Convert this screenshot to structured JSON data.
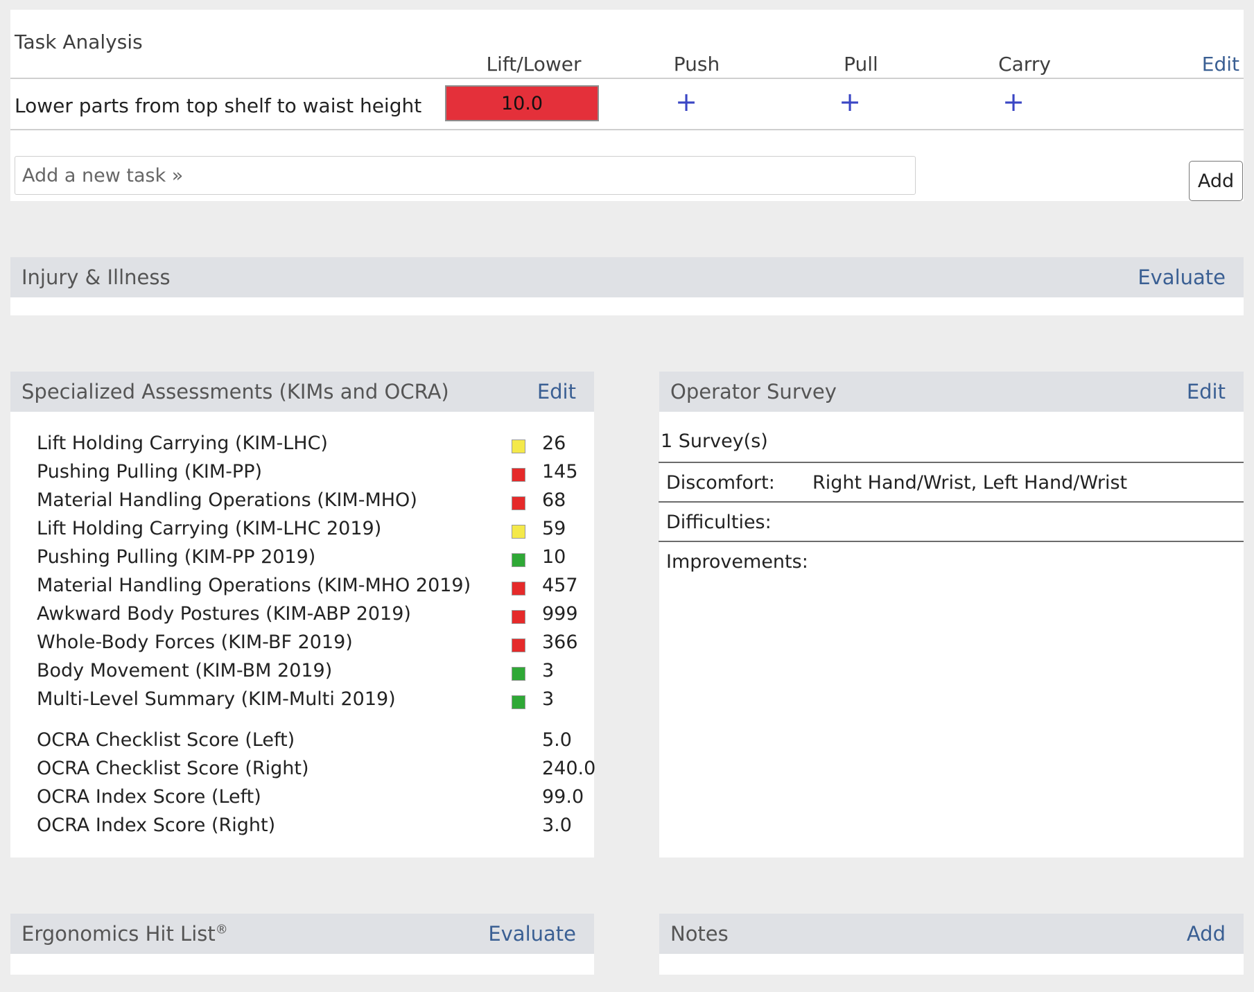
{
  "task_analysis": {
    "title": "Task Analysis",
    "columns": [
      "Lift/Lower",
      "Push",
      "Pull",
      "Carry"
    ],
    "edit_label": "Edit",
    "task": {
      "name": "Lower parts from top shelf to waist height",
      "lift_lower_score": "10.0",
      "score_color": "#e4303a"
    },
    "add_symbol": "+",
    "new_task_placeholder": "Add a new task »",
    "add_button": "Add"
  },
  "injury_illness": {
    "title": "Injury & Illness",
    "action": "Evaluate"
  },
  "specialized": {
    "title": "Specialized Assessments (KIMs and OCRA)",
    "action": "Edit",
    "kims": [
      {
        "label": "Lift Holding Carrying (KIM-LHC)",
        "value": "26",
        "level": "yellow"
      },
      {
        "label": "Pushing Pulling (KIM-PP)",
        "value": "145",
        "level": "red"
      },
      {
        "label": "Material Handling Operations (KIM-MHO)",
        "value": "68",
        "level": "red"
      },
      {
        "label": "Lift Holding Carrying (KIM-LHC 2019)",
        "value": "59",
        "level": "yellow"
      },
      {
        "label": "Pushing Pulling (KIM-PP 2019)",
        "value": "10",
        "level": "green"
      },
      {
        "label": "Material Handling Operations (KIM-MHO 2019)",
        "value": "457",
        "level": "red"
      },
      {
        "label": "Awkward Body Postures (KIM-ABP 2019)",
        "value": "999",
        "level": "red"
      },
      {
        "label": "Whole-Body Forces (KIM-BF 2019)",
        "value": "366",
        "level": "red"
      },
      {
        "label": "Body Movement (KIM-BM 2019)",
        "value": "3",
        "level": "green"
      },
      {
        "label": "Multi-Level Summary (KIM-Multi 2019)",
        "value": "3",
        "level": "green"
      }
    ],
    "ocra": [
      {
        "label": "OCRA Checklist Score (Left)",
        "value": "5.0"
      },
      {
        "label": "OCRA Checklist Score (Right)",
        "value": "240.0"
      },
      {
        "label": "OCRA Index Score (Left)",
        "value": "99.0"
      },
      {
        "label": "OCRA Index Score (Right)",
        "value": "3.0"
      }
    ],
    "level_colors": {
      "yellow": "#f4e94a",
      "red": "#e52a2a",
      "green": "#2fa836"
    }
  },
  "operator_survey": {
    "title": "Operator Survey",
    "action": "Edit",
    "count": "1 Survey(s)",
    "discomfort_label": "Discomfort:",
    "discomfort_value": "Right Hand/Wrist, Left Hand/Wrist",
    "difficulties_label": "Difficulties:",
    "improvements_label": "Improvements:"
  },
  "hit_list": {
    "title": "Ergonomics Hit List",
    "trademark": "®",
    "action": "Evaluate"
  },
  "notes": {
    "title": "Notes",
    "action": "Add"
  }
}
